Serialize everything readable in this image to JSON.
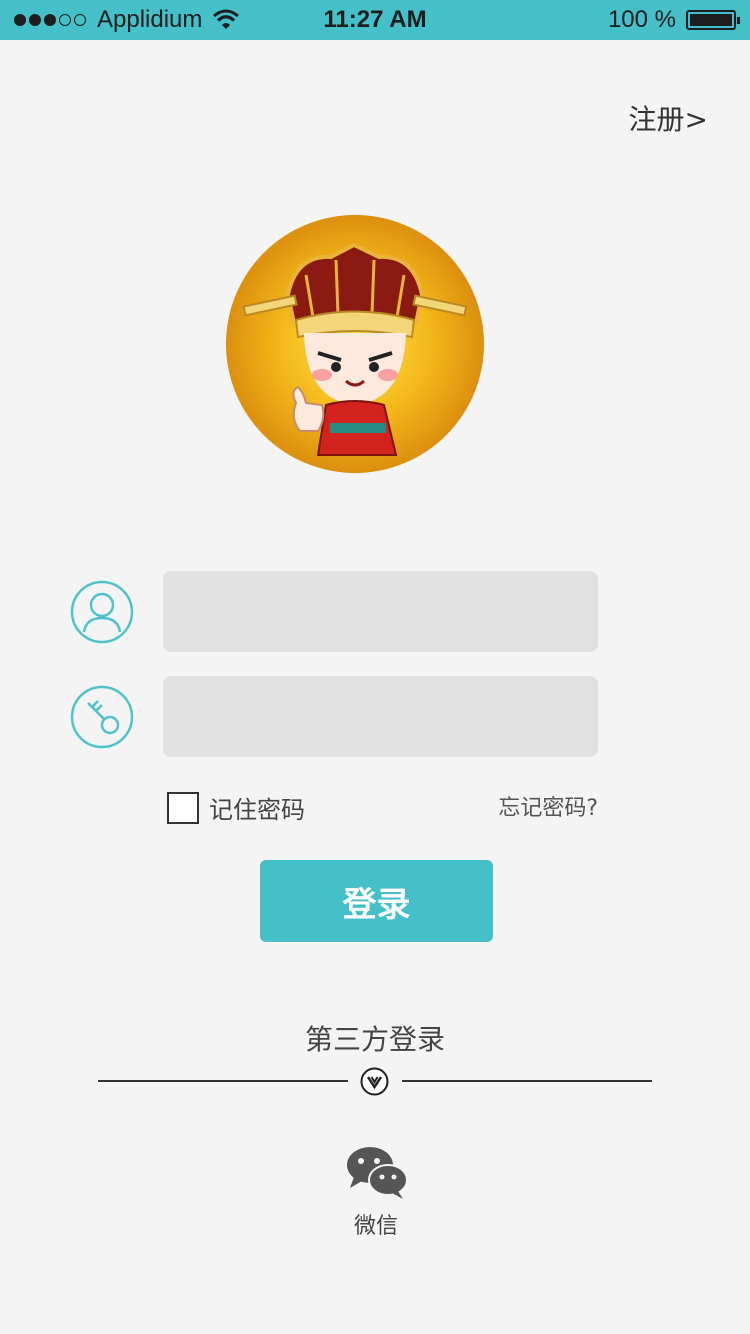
{
  "status_bar": {
    "carrier": "Applidium",
    "time": "11:27 AM",
    "battery": "100 %",
    "signal_bars_filled": 3,
    "signal_bars_total": 5
  },
  "header": {
    "register_label": "注册>"
  },
  "login_form": {
    "username_value": "",
    "password_value": "",
    "remember_label": "记住密码",
    "remember_checked": false,
    "forgot_label": "忘记密码?",
    "login_button_label": "登录"
  },
  "third_party": {
    "title": "第三方登录",
    "providers": [
      {
        "label": "微信",
        "icon": "wechat-icon"
      }
    ]
  },
  "colors": {
    "accent": "#45bfc8",
    "background": "#f4f4f4",
    "input_background": "#e1e1e1"
  }
}
